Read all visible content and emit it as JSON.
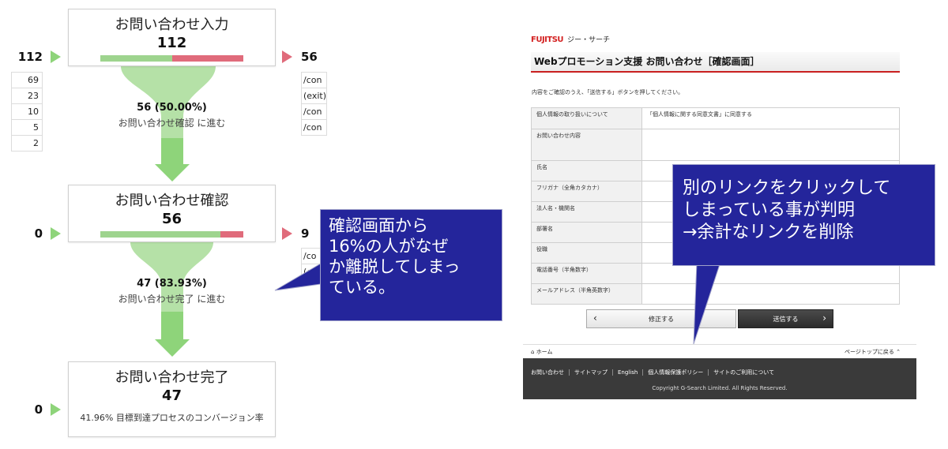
{
  "funnel": {
    "stages": [
      {
        "title": "お問い合わせ入力",
        "count": "112",
        "entries": "112",
        "exits": "56",
        "fill": 0.5
      },
      {
        "title": "お問い合わせ確認",
        "count": "56",
        "entries": "0",
        "exits": "9",
        "fill": 0.84
      },
      {
        "title": "お問い合わせ完了",
        "count": "47",
        "entries": "0",
        "footnote": "41.96% 目標到達プロセスのコンバージョン率"
      }
    ],
    "flows": [
      {
        "pct": "56 (50.00%)",
        "sub": "お問い合わせ確認 に進む"
      },
      {
        "pct": "47 (83.93%)",
        "sub": "お問い合わせ完了 に進む"
      }
    ],
    "source_values": [
      "69",
      "23",
      "10",
      "5",
      "2"
    ],
    "exit_pages_1": [
      "/con",
      "(exit)",
      "/con",
      "/con"
    ],
    "exit_pages_2": [
      "/co",
      "(exi"
    ]
  },
  "callouts": {
    "left": "確認画面から\n16%の人がなぜ\nか離脱してしまっ\nている。",
    "right": "別のリンクをクリックして\nしまっている事が判明\n→余計なリンクを削除"
  },
  "site": {
    "logo_brand": "FUJITSU",
    "logo_sub": "ジー・サーチ",
    "page_title": "Webプロモーション支援 お問い合わせ［確認画面］",
    "note": "内容をご確認のうえ、「送信する」ボタンを押してください。",
    "rows": [
      {
        "label": "個人情報の取り扱いについて",
        "value": "「個人情報に関する同意文書」に同意する"
      },
      {
        "label": "お問い合わせ内容",
        "value": ""
      },
      {
        "label": "氏名",
        "value": ""
      },
      {
        "label": "フリガナ（全角カタカナ）",
        "value": ""
      },
      {
        "label": "法人名・機関名",
        "value": ""
      },
      {
        "label": "部署名",
        "value": ""
      },
      {
        "label": "役職",
        "value": ""
      },
      {
        "label": "電話番号（半角数字）",
        "value": ""
      },
      {
        "label": "メールアドレス（半角英数字）",
        "value": ""
      }
    ],
    "back_label": "修正する",
    "send_label": "送信する",
    "home_label": "ホーム",
    "pagetop_label": "ページトップに戻る",
    "footer_links": [
      "お問い合わせ",
      "サイトマップ",
      "English",
      "個人情報保護ポリシー",
      "サイトのご利用について"
    ],
    "copyright": "Copyright G-Search Limited. All Rights Reserved."
  }
}
